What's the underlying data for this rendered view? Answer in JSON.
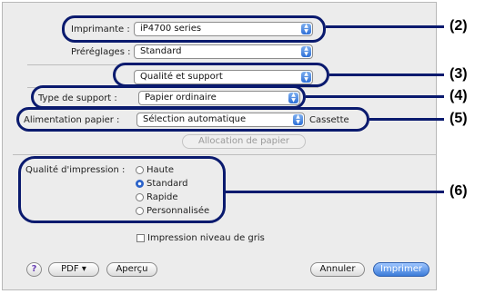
{
  "printer": {
    "label": "Imprimante :",
    "value": "iP4700 series"
  },
  "presets": {
    "label": "Préréglages :",
    "value": "Standard"
  },
  "section": {
    "value": "Qualité et support"
  },
  "media_type": {
    "label": "Type de support :",
    "value": "Papier ordinaire"
  },
  "paper_source": {
    "label": "Alimentation papier :",
    "value": "Sélection automatique",
    "extra": "Cassette"
  },
  "paper_allocation_button": "Allocation de papier",
  "print_quality": {
    "label": "Qualité d'impression :",
    "options": [
      "Haute",
      "Standard",
      "Rapide",
      "Personnalisée"
    ],
    "selected": "Standard"
  },
  "grayscale": {
    "label": "Impression niveau de gris",
    "checked": false
  },
  "footer": {
    "help": "?",
    "pdf": "PDF ▾",
    "preview": "Aperçu",
    "cancel": "Annuler",
    "print": "Imprimer"
  },
  "callouts": [
    "(2)",
    "(3)",
    "(4)",
    "(5)",
    "(6)"
  ],
  "colors": {
    "callout_ring": "#0a1a6e",
    "primary_button": "#3b7bd8",
    "popup_arrow": "#2d6fd6"
  }
}
